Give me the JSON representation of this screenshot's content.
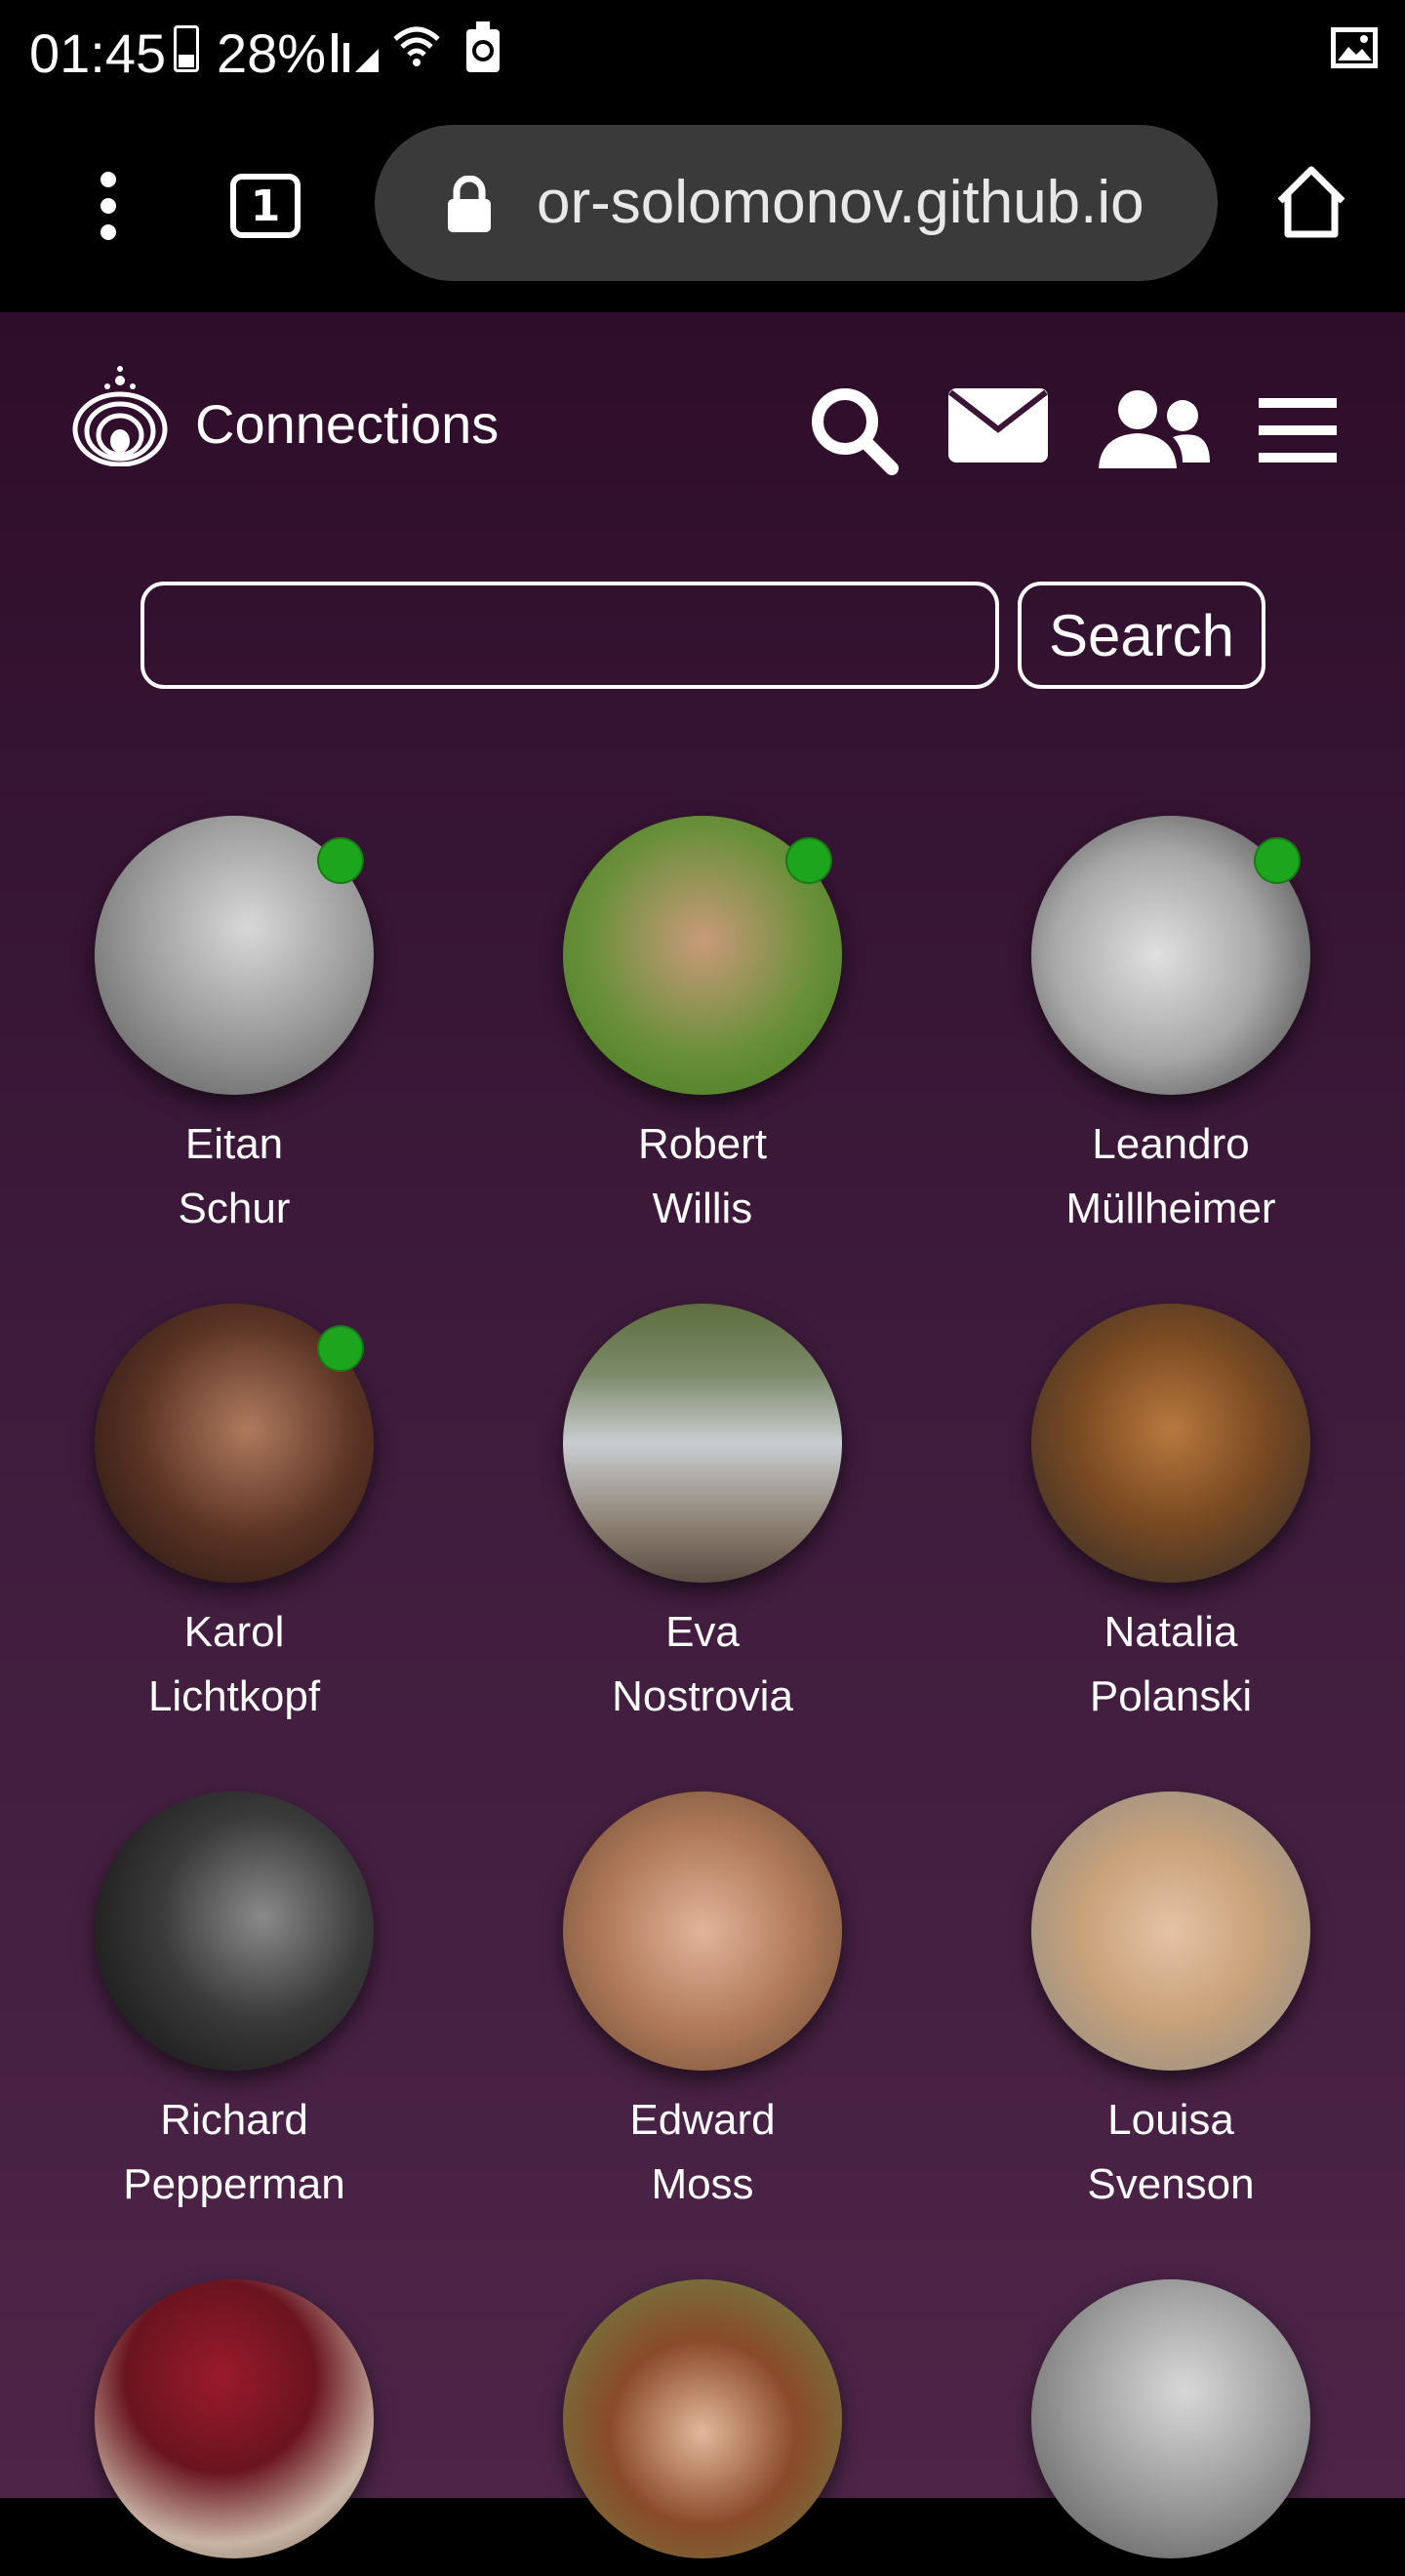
{
  "status_bar": {
    "time": "01:45",
    "battery": "28%",
    "icons": [
      "battery-icon",
      "signal-icon",
      "wifi-icon",
      "recycle-icon",
      "image-icon"
    ]
  },
  "browser": {
    "tab_count": "1",
    "url": "or-solomonov.github.io",
    "icons": [
      "menu-dots-icon",
      "lock-icon",
      "home-icon"
    ]
  },
  "header": {
    "title": "Connections",
    "nav_icons": [
      "search-icon",
      "envelope-icon",
      "users-icon",
      "hamburger-menu-icon"
    ]
  },
  "search": {
    "placeholder": "",
    "value": "",
    "button_label": "Search"
  },
  "colors": {
    "background_top": "#2e0d2a",
    "background_bottom": "#4d2548",
    "online": "#1ea51e",
    "url_bar": "#3a3a3a"
  },
  "contacts": [
    {
      "first": "Eitan",
      "last": "Schur",
      "online": true
    },
    {
      "first": "Robert",
      "last": "Willis",
      "online": true
    },
    {
      "first": "Leandro",
      "last": "Müllheimer",
      "online": true
    },
    {
      "first": "Karol",
      "last": "Lichtkopf",
      "online": true
    },
    {
      "first": "Eva",
      "last": "Nostrovia",
      "online": false
    },
    {
      "first": "Natalia",
      "last": "Polanski",
      "online": false
    },
    {
      "first": "Richard",
      "last": "Pepperman",
      "online": false
    },
    {
      "first": "Edward",
      "last": "Moss",
      "online": false
    },
    {
      "first": "Louisa",
      "last": "Svenson",
      "online": false
    },
    {
      "first": "",
      "last": "",
      "online": false
    },
    {
      "first": "",
      "last": "",
      "online": false
    },
    {
      "first": "",
      "last": "",
      "online": false
    }
  ]
}
